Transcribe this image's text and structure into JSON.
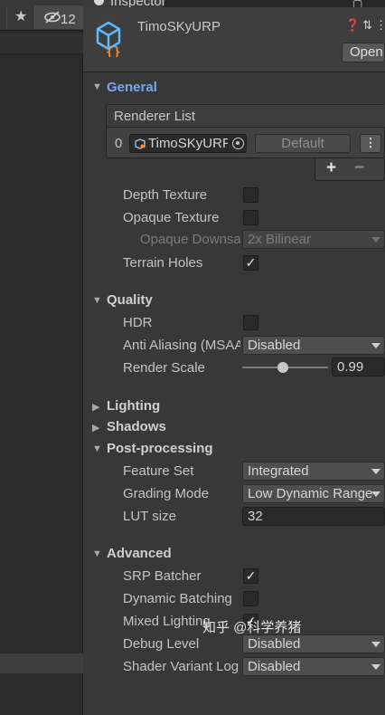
{
  "left_panel": {
    "visibility_count": "12"
  },
  "tab": {
    "label": "Inspector"
  },
  "header": {
    "title": "TimoSKyURP",
    "open_label": "Open"
  },
  "general": {
    "title": "General",
    "renderer_list": {
      "title": "Renderer List",
      "index": "0",
      "renderer": "TimoSKyURP",
      "default_label": "Default",
      "add": "+",
      "remove": "−"
    },
    "depth_texture": {
      "label": "Depth Texture",
      "checked": false
    },
    "opaque_texture": {
      "label": "Opaque Texture",
      "checked": false
    },
    "opaque_downsampling": {
      "label": "Opaque Downsampling",
      "value": "2x Bilinear"
    },
    "terrain_holes": {
      "label": "Terrain Holes",
      "checked": true
    }
  },
  "quality": {
    "title": "Quality",
    "hdr": {
      "label": "HDR",
      "checked": false
    },
    "anti_aliasing": {
      "label": "Anti Aliasing (MSAA)",
      "value": "Disabled"
    },
    "render_scale": {
      "label": "Render Scale",
      "value": "0.99",
      "fraction": 0.99
    }
  },
  "lighting": {
    "title": "Lighting"
  },
  "shadows": {
    "title": "Shadows"
  },
  "post_processing": {
    "title": "Post-processing",
    "feature_set": {
      "label": "Feature Set",
      "value": "Integrated"
    },
    "grading_mode": {
      "label": "Grading Mode",
      "value": "Low Dynamic Range"
    },
    "lut_size": {
      "label": "LUT size",
      "value": "32"
    }
  },
  "advanced": {
    "title": "Advanced",
    "srp_batcher": {
      "label": "SRP Batcher",
      "checked": true
    },
    "dynamic_batching": {
      "label": "Dynamic Batching",
      "checked": false
    },
    "mixed_lighting": {
      "label": "Mixed Lighting",
      "checked": true
    },
    "debug_level": {
      "label": "Debug Level",
      "value": "Disabled"
    },
    "shader_variant_log": {
      "label": "Shader Variant Log Level",
      "value": "Disabled"
    }
  },
  "watermark": "知乎 @科学养猪",
  "colors": {
    "accent": "#7ba7e8",
    "background": "#383838",
    "field": "#2a2a2a"
  }
}
